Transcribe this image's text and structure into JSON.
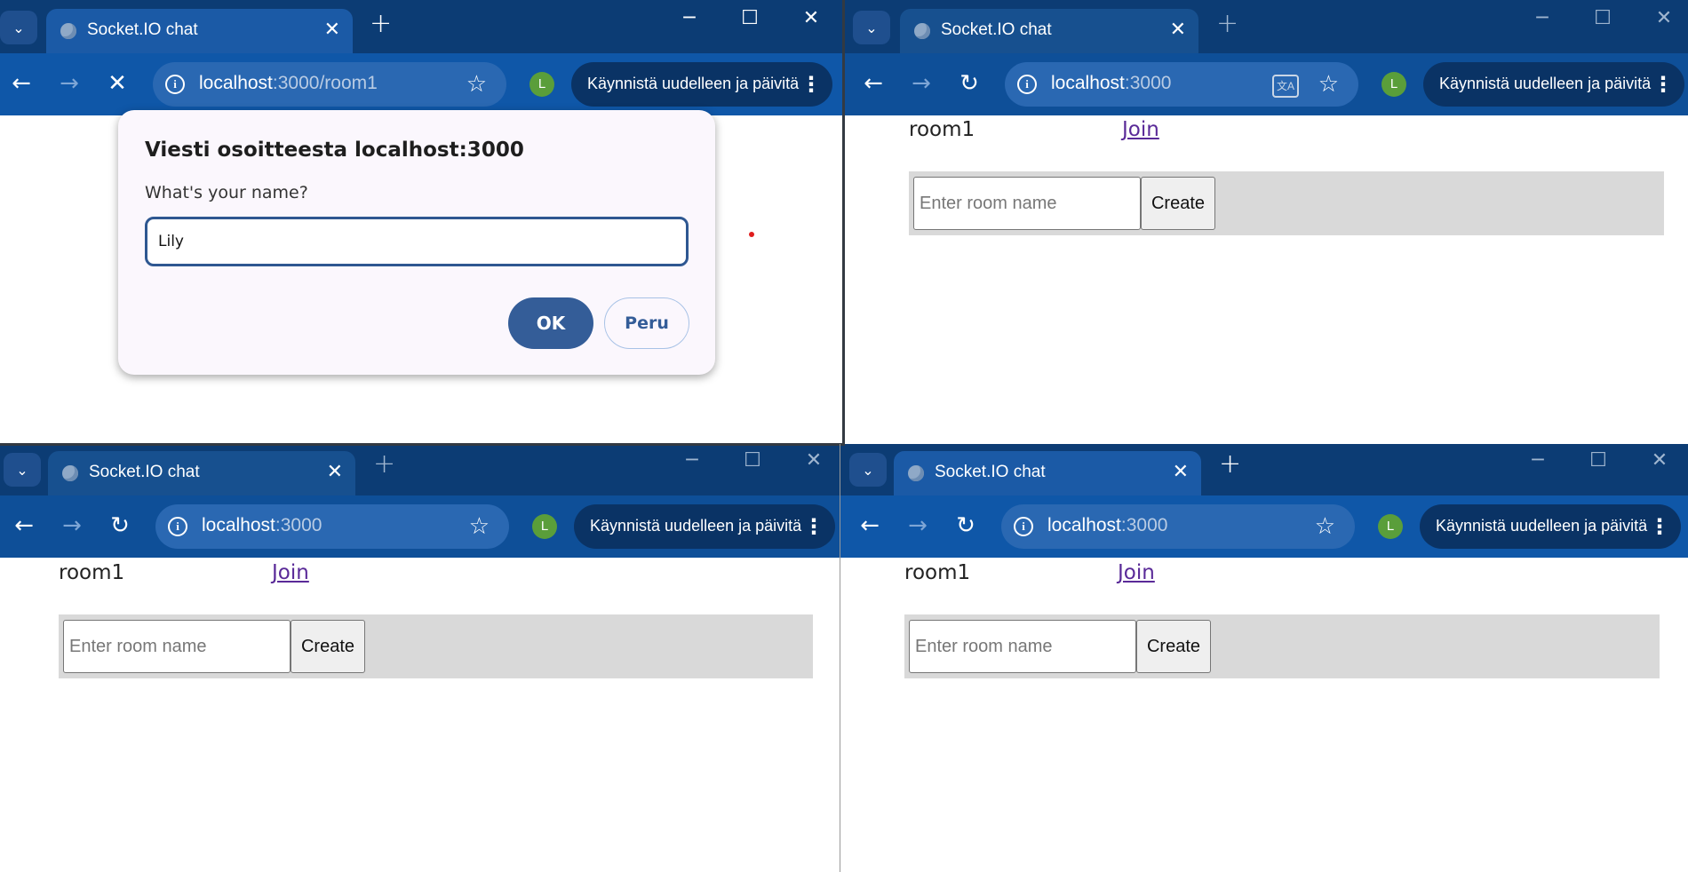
{
  "windows": [
    {
      "tab_title": "Socket.IO chat",
      "url_host": "localhost",
      "url_path": ":3000/room1",
      "avatar_initial": "L",
      "update_label": "Käynnistä uudelleen ja päivitä",
      "dialog": {
        "title": "Viesti osoitteesta localhost:3000",
        "message": "What's your name?",
        "input_value": "Lily",
        "ok_label": "OK",
        "cancel_label": "Peru"
      }
    },
    {
      "tab_title": "Socket.IO chat",
      "url_host": "localhost",
      "url_path": ":3000",
      "avatar_initial": "L",
      "update_label": "Käynnistä uudelleen ja päivitä",
      "room_name": "room1",
      "join_label": "Join",
      "input_placeholder": "Enter room name",
      "create_label": "Create"
    },
    {
      "tab_title": "Socket.IO chat",
      "url_host": "localhost",
      "url_path": ":3000",
      "avatar_initial": "L",
      "update_label": "Käynnistä uudelleen ja päivitä",
      "room_name": "room1",
      "join_label": "Join",
      "input_placeholder": "Enter room name",
      "create_label": "Create"
    },
    {
      "tab_title": "Socket.IO chat",
      "url_host": "localhost",
      "url_path": ":3000",
      "avatar_initial": "L",
      "update_label": "Käynnistä uudelleen ja päivitä",
      "room_name": "room1",
      "join_label": "Join",
      "input_placeholder": "Enter room name",
      "create_label": "Create"
    }
  ],
  "icons": {
    "tab_search": "chevron-down-icon",
    "close": "close-icon",
    "new_tab": "plus-icon",
    "back": "arrow-left-icon",
    "forward": "arrow-right-icon",
    "reload": "reload-icon",
    "stop": "stop-icon",
    "site_info": "info-icon",
    "bookmark": "star-icon",
    "translate": "translate-icon",
    "menu": "kebab-menu-icon"
  },
  "colors": {
    "tab_strip": "#0c3c74",
    "toolbar": "#0f57a8",
    "avatar": "#5a9e3a",
    "dialog_button": "#345d98",
    "link": "#5a2a98",
    "create_bar": "#d9d9d9"
  }
}
